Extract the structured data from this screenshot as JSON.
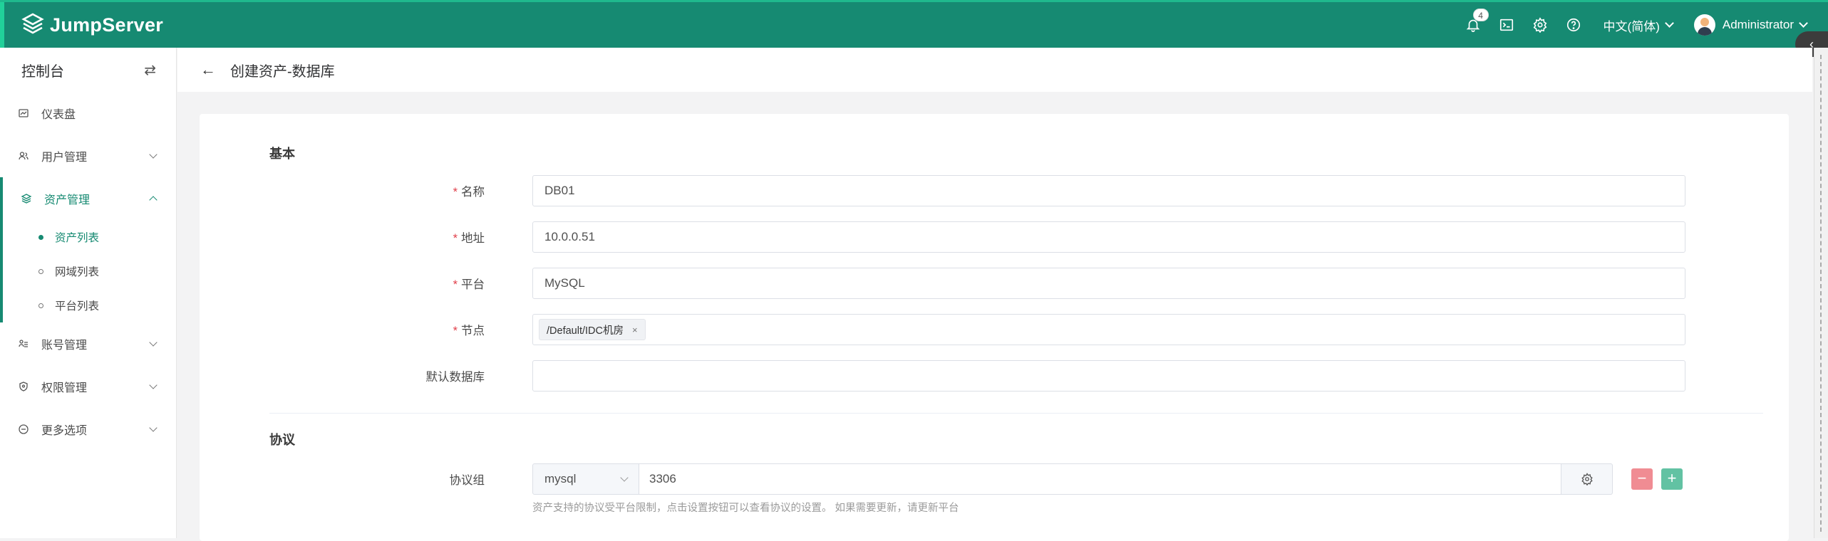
{
  "header": {
    "app_name": "JumpServer",
    "notification_count": "4",
    "language": "中文(简体)",
    "user_name": "Administrator",
    "collapse_label": "‹"
  },
  "sidebar": {
    "title": "控制台",
    "switch_icon": "⇄",
    "items": [
      {
        "label": "仪表盘",
        "icon": "dashboard-icon"
      },
      {
        "label": "用户管理",
        "icon": "users-icon"
      },
      {
        "label": "资产管理",
        "icon": "layers-icon"
      },
      {
        "label": "账号管理",
        "icon": "account-icon"
      },
      {
        "label": "权限管理",
        "icon": "shield-icon"
      },
      {
        "label": "更多选项",
        "icon": "more-icon"
      }
    ],
    "asset_sub": [
      {
        "label": "资产列表",
        "active": true
      },
      {
        "label": "网域列表",
        "active": false
      },
      {
        "label": "平台列表",
        "active": false
      }
    ]
  },
  "page": {
    "title": "创建资产-数据库",
    "back_icon": "←"
  },
  "form": {
    "basic_title": "基本",
    "required_mark": "*",
    "name_label": "名称",
    "name_value": "DB01",
    "address_label": "地址",
    "address_value": "10.0.0.51",
    "platform_label": "平台",
    "platform_value": "MySQL",
    "node_label": "节点",
    "node_tag": "/Default/IDC机房",
    "node_tag_close": "×",
    "default_db_label": "默认数据库",
    "default_db_value": "",
    "protocol_title": "协议",
    "protocol_group_label": "协议组",
    "protocol_name": "mysql",
    "protocol_port": "3306",
    "minus_label": "−",
    "plus_label": "+",
    "protocol_hint": "资产支持的协议受平台限制，点击设置按钮可以查看协议的设置。 如果需要更新，请更新平台"
  },
  "colors": {
    "brand": "#168a72",
    "required": "#e0404b",
    "danger_button": "#f08c93",
    "success_button": "#62c2a3"
  }
}
